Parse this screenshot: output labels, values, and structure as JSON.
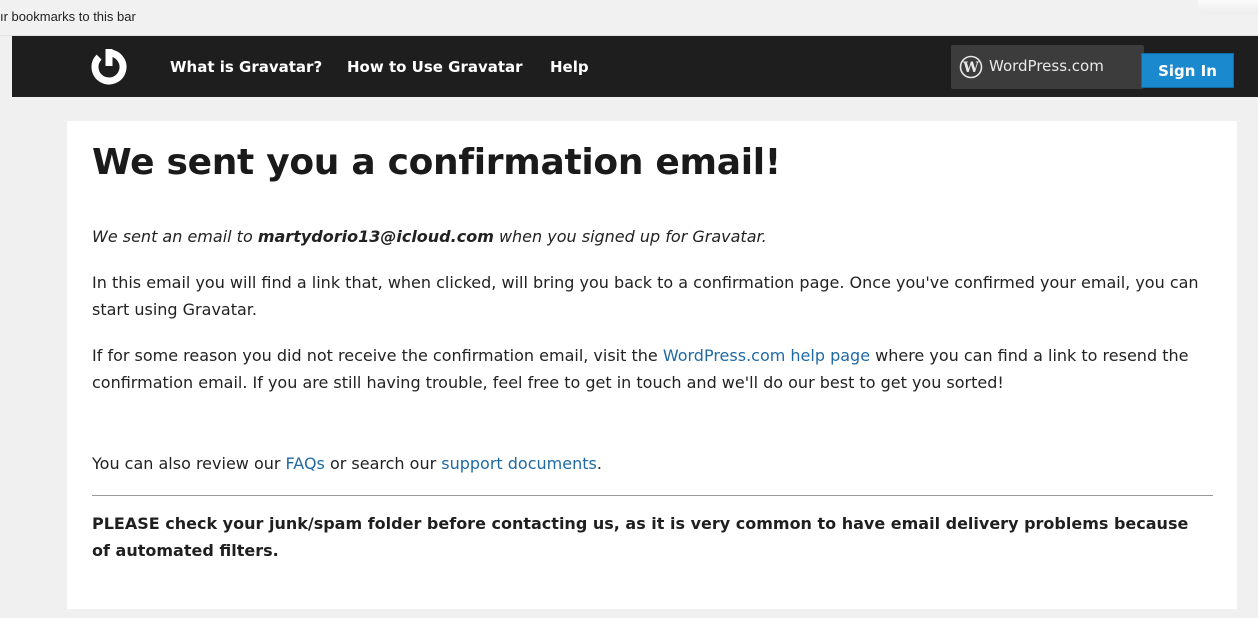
{
  "browser": {
    "bookmarks_hint": "ır bookmarks to this bar"
  },
  "masthead": {
    "logo_icon": "gravatar-logo-icon",
    "nav": [
      {
        "label": "What is Gravatar?"
      },
      {
        "label": "How to Use Gravatar"
      },
      {
        "label": "Help"
      }
    ],
    "wpcom_icon": "wordpress-icon",
    "wpcom_label": "WordPress.com",
    "signin_label": "Sign In",
    "colors": {
      "bar": "#1e1e1e",
      "signin": "#1a89cd",
      "wpcom_box": "#3c3c3c"
    }
  },
  "content": {
    "title": "We sent you a confirmation email!",
    "sent_prefix": "We sent an email to ",
    "email": "martydorio13@icloud.com",
    "sent_suffix": " when you signed up for Gravatar.",
    "para2": "In this email you will find a link that, when clicked, will bring you back to a confirmation page. Once you've confirmed your email, you can start using Gravatar.",
    "para3_prefix": "If for some reason you did not receive the confirmation email, visit the ",
    "para3_link": "WordPress.com help page",
    "para3_suffix": " where you can find a link to resend the confirmation email. If you are still having trouble, feel free to get in touch and we'll do our best to get you sorted!",
    "para4_prefix": "You can also review our ",
    "faqs_link": "FAQs",
    "para4_mid": " or search our ",
    "support_link": "support documents",
    "para4_suffix": ".",
    "notice": "PLEASE check your junk/spam folder before contacting us, as it is very common to have email delivery problems because of automated filters.",
    "link_color": "#1f6aa5"
  }
}
